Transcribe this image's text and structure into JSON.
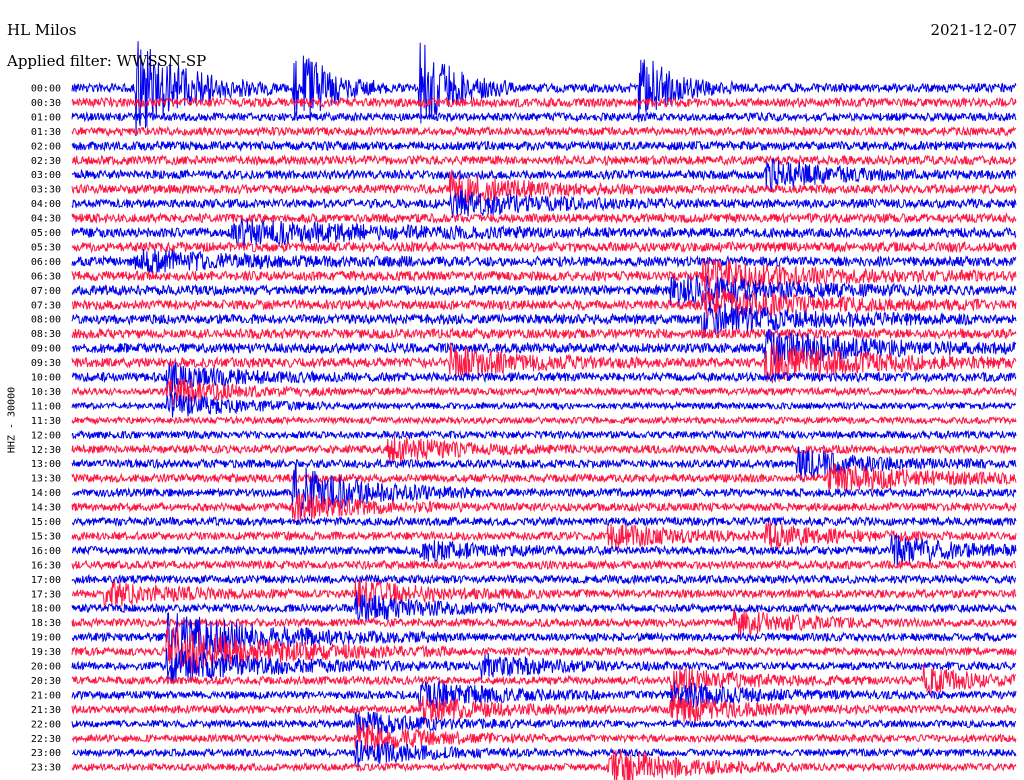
{
  "header": {
    "station": "HL Milos",
    "filter": "Applied filter: WWSSN-SP",
    "date": "2021-12-07"
  },
  "colors": {
    "trace_a": "#0000ee",
    "trace_b": "#ff1744",
    "background": "#ffffff"
  },
  "chart_data": {
    "type": "line",
    "title": "HL Milos",
    "subtitle": "Applied filter: WWSSN-SP",
    "ylabel": "HHZ - 30000",
    "date": "2021-12-07",
    "row_minutes": 30,
    "row_labels": [
      "00:00",
      "00:30",
      "01:00",
      "01:30",
      "02:00",
      "02:30",
      "03:00",
      "03:30",
      "04:00",
      "04:30",
      "05:00",
      "05:30",
      "06:00",
      "06:30",
      "07:00",
      "07:30",
      "08:00",
      "08:30",
      "09:00",
      "09:30",
      "10:00",
      "10:30",
      "11:00",
      "11:30",
      "12:00",
      "12:30",
      "13:00",
      "13:30",
      "14:00",
      "14:30",
      "15:00",
      "15:30",
      "16:00",
      "16:30",
      "17:00",
      "17:30",
      "18:00",
      "18:30",
      "19:00",
      "19:30",
      "20:00",
      "20:30",
      "21:00",
      "21:30",
      "22:00",
      "22:30",
      "23:00",
      "23:30"
    ],
    "row_colors": [
      "blue",
      "red",
      "blue",
      "red",
      "blue",
      "red",
      "blue",
      "red",
      "blue",
      "red",
      "blue",
      "red",
      "blue",
      "red",
      "blue",
      "red",
      "blue",
      "red",
      "blue",
      "red",
      "blue",
      "red",
      "blue",
      "red",
      "blue",
      "red",
      "blue",
      "red",
      "blue",
      "red",
      "blue",
      "red",
      "blue",
      "red",
      "blue",
      "red",
      "blue",
      "red",
      "blue",
      "red",
      "blue",
      "red",
      "blue",
      "red",
      "blue",
      "red",
      "blue",
      "red"
    ],
    "noise_amplitude": [
      0.55,
      0.55,
      0.5,
      0.5,
      0.55,
      0.55,
      0.55,
      0.55,
      0.55,
      0.55,
      0.6,
      0.6,
      0.6,
      0.6,
      0.6,
      0.6,
      0.6,
      0.6,
      0.6,
      0.6,
      0.55,
      0.45,
      0.4,
      0.4,
      0.45,
      0.5,
      0.5,
      0.5,
      0.5,
      0.5,
      0.5,
      0.5,
      0.5,
      0.5,
      0.5,
      0.5,
      0.5,
      0.5,
      0.5,
      0.5,
      0.5,
      0.5,
      0.5,
      0.5,
      0.45,
      0.45,
      0.45,
      0.45
    ],
    "events": [
      {
        "row": 0,
        "minute": 2,
        "amplitude": 6.0,
        "duration_min": 1.5
      },
      {
        "row": 0,
        "minute": 7,
        "amplitude": 6.0,
        "duration_min": 1
      },
      {
        "row": 0,
        "minute": 11,
        "amplitude": 6.0,
        "duration_min": 1
      },
      {
        "row": 0,
        "minute": 18,
        "amplitude": 4.5,
        "duration_min": 1
      },
      {
        "row": 6,
        "minute": 22,
        "amplitude": 1.8,
        "duration_min": 2
      },
      {
        "row": 7,
        "minute": 12,
        "amplitude": 2.0,
        "duration_min": 2
      },
      {
        "row": 8,
        "minute": 12,
        "amplitude": 1.6,
        "duration_min": 2.5
      },
      {
        "row": 10,
        "minute": 5,
        "amplitude": 1.5,
        "duration_min": 4
      },
      {
        "row": 12,
        "minute": 2,
        "amplitude": 1.2,
        "duration_min": 3
      },
      {
        "row": 13,
        "minute": 20,
        "amplitude": 1.8,
        "duration_min": 3
      },
      {
        "row": 14,
        "minute": 19,
        "amplitude": 2.0,
        "duration_min": 3
      },
      {
        "row": 15,
        "minute": 20,
        "amplitude": 1.8,
        "duration_min": 3
      },
      {
        "row": 16,
        "minute": 20,
        "amplitude": 1.8,
        "duration_min": 3
      },
      {
        "row": 18,
        "minute": 22,
        "amplitude": 2.0,
        "duration_min": 3
      },
      {
        "row": 19,
        "minute": 12,
        "amplitude": 2.0,
        "duration_min": 2
      },
      {
        "row": 19,
        "minute": 22,
        "amplitude": 2.2,
        "duration_min": 3
      },
      {
        "row": 20,
        "minute": 3,
        "amplitude": 1.6,
        "duration_min": 2
      },
      {
        "row": 21,
        "minute": 3,
        "amplitude": 1.5,
        "duration_min": 2
      },
      {
        "row": 22,
        "minute": 3,
        "amplitude": 1.5,
        "duration_min": 2
      },
      {
        "row": 25,
        "minute": 10,
        "amplitude": 1.5,
        "duration_min": 2
      },
      {
        "row": 26,
        "minute": 23,
        "amplitude": 1.8,
        "duration_min": 2
      },
      {
        "row": 27,
        "minute": 24,
        "amplitude": 1.6,
        "duration_min": 3
      },
      {
        "row": 28,
        "minute": 7,
        "amplitude": 1.8,
        "duration_min": 2
      },
      {
        "row": 28,
        "minute": 7,
        "amplitude": 1.5,
        "duration_min": 2
      },
      {
        "row": 29,
        "minute": 7,
        "amplitude": 1.5,
        "duration_min": 2
      },
      {
        "row": 31,
        "minute": 17,
        "amplitude": 1.4,
        "duration_min": 2
      },
      {
        "row": 31,
        "minute": 22,
        "amplitude": 1.4,
        "duration_min": 2
      },
      {
        "row": 32,
        "minute": 11,
        "amplitude": 1.2,
        "duration_min": 2
      },
      {
        "row": 32,
        "minute": 26,
        "amplitude": 1.6,
        "duration_min": 2
      },
      {
        "row": 35,
        "minute": 1,
        "amplitude": 1.5,
        "duration_min": 2
      },
      {
        "row": 35,
        "minute": 9,
        "amplitude": 1.6,
        "duration_min": 2
      },
      {
        "row": 36,
        "minute": 9,
        "amplitude": 1.6,
        "duration_min": 2
      },
      {
        "row": 37,
        "minute": 21,
        "amplitude": 1.4,
        "duration_min": 2
      },
      {
        "row": 38,
        "minute": 3,
        "amplitude": 3.0,
        "duration_min": 3
      },
      {
        "row": 39,
        "minute": 3,
        "amplitude": 3.0,
        "duration_min": 3
      },
      {
        "row": 40,
        "minute": 3,
        "amplitude": 2.0,
        "duration_min": 3
      },
      {
        "row": 40,
        "minute": 13,
        "amplitude": 1.4,
        "duration_min": 2
      },
      {
        "row": 41,
        "minute": 19,
        "amplitude": 1.6,
        "duration_min": 2
      },
      {
        "row": 41,
        "minute": 27,
        "amplitude": 1.6,
        "duration_min": 1.5
      },
      {
        "row": 42,
        "minute": 11,
        "amplitude": 1.8,
        "duration_min": 2
      },
      {
        "row": 42,
        "minute": 19,
        "amplitude": 1.6,
        "duration_min": 2
      },
      {
        "row": 43,
        "minute": 11,
        "amplitude": 1.5,
        "duration_min": 2
      },
      {
        "row": 43,
        "minute": 19,
        "amplitude": 1.5,
        "duration_min": 2
      },
      {
        "row": 44,
        "minute": 9,
        "amplitude": 1.4,
        "duration_min": 2
      },
      {
        "row": 45,
        "minute": 9,
        "amplitude": 1.8,
        "duration_min": 2
      },
      {
        "row": 46,
        "minute": 9,
        "amplitude": 1.5,
        "duration_min": 2
      },
      {
        "row": 47,
        "minute": 17,
        "amplitude": 2.6,
        "duration_min": 2
      }
    ]
  }
}
